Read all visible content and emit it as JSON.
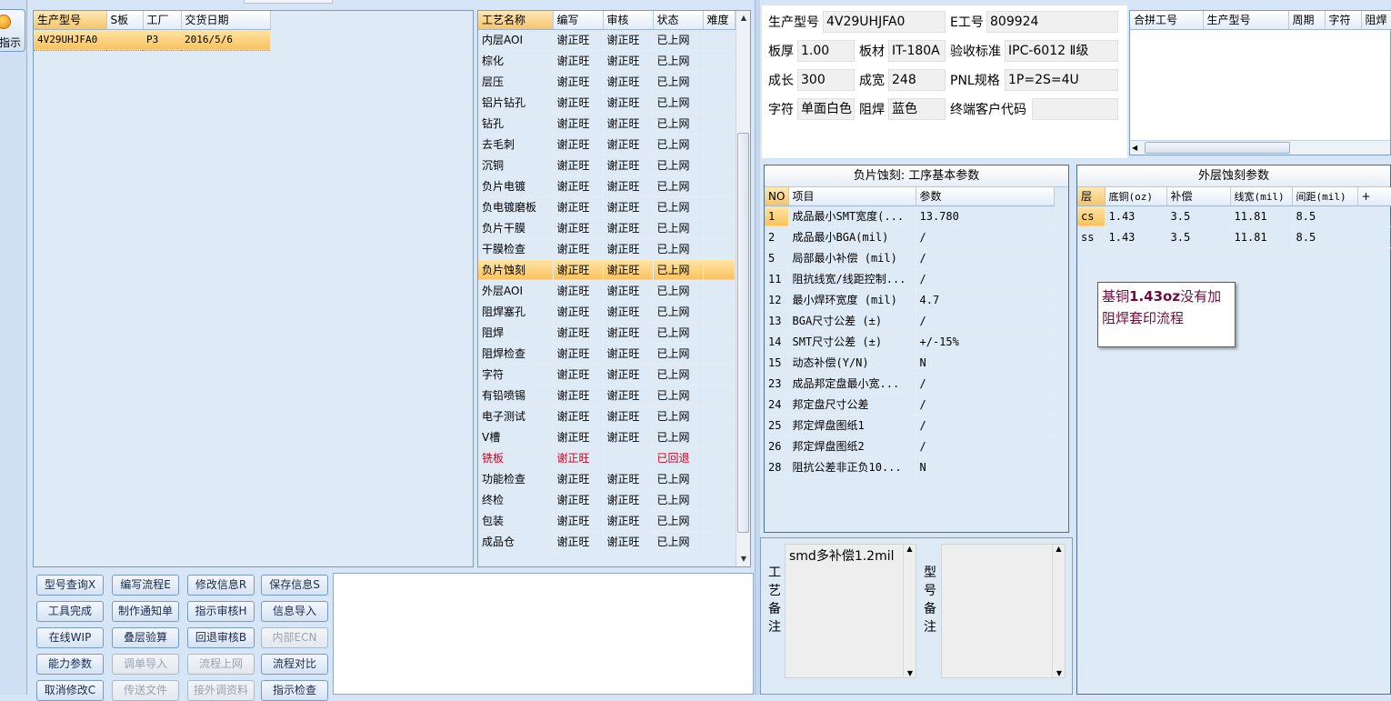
{
  "left_button": {
    "label": "指示"
  },
  "orders": {
    "columns": [
      "生产型号",
      "S板",
      "工厂",
      "交货日期"
    ],
    "rows": [
      [
        "4V29UHJFA0",
        "",
        "P3",
        "2016/5/6"
      ]
    ]
  },
  "process": {
    "columns": [
      "工艺名称",
      "编写",
      "审核",
      "状态",
      "难度"
    ],
    "rows": [
      [
        "内层AOI",
        "谢正旺",
        "谢正旺",
        "已上网",
        ""
      ],
      [
        "棕化",
        "谢正旺",
        "谢正旺",
        "已上网",
        ""
      ],
      [
        "层压",
        "谢正旺",
        "谢正旺",
        "已上网",
        ""
      ],
      [
        "铝片钻孔",
        "谢正旺",
        "谢正旺",
        "已上网",
        ""
      ],
      [
        "钻孔",
        "谢正旺",
        "谢正旺",
        "已上网",
        ""
      ],
      [
        "去毛刺",
        "谢正旺",
        "谢正旺",
        "已上网",
        ""
      ],
      [
        "沉铜",
        "谢正旺",
        "谢正旺",
        "已上网",
        ""
      ],
      [
        "负片电镀",
        "谢正旺",
        "谢正旺",
        "已上网",
        ""
      ],
      [
        "负电镀磨板",
        "谢正旺",
        "谢正旺",
        "已上网",
        ""
      ],
      [
        "负片干膜",
        "谢正旺",
        "谢正旺",
        "已上网",
        ""
      ],
      [
        "干膜检查",
        "谢正旺",
        "谢正旺",
        "已上网",
        ""
      ],
      [
        "负片蚀刻",
        "谢正旺",
        "谢正旺",
        "已上网",
        ""
      ],
      [
        "外层AOI",
        "谢正旺",
        "谢正旺",
        "已上网",
        ""
      ],
      [
        "阻焊塞孔",
        "谢正旺",
        "谢正旺",
        "已上网",
        ""
      ],
      [
        "阻焊",
        "谢正旺",
        "谢正旺",
        "已上网",
        ""
      ],
      [
        "阻焊检查",
        "谢正旺",
        "谢正旺",
        "已上网",
        ""
      ],
      [
        "字符",
        "谢正旺",
        "谢正旺",
        "已上网",
        ""
      ],
      [
        "有铅喷锡",
        "谢正旺",
        "谢正旺",
        "已上网",
        ""
      ],
      [
        "电子测试",
        "谢正旺",
        "谢正旺",
        "已上网",
        ""
      ],
      [
        "V槽",
        "谢正旺",
        "谢正旺",
        "已上网",
        ""
      ],
      [
        "铣板",
        "谢正旺",
        "",
        "已回退",
        ""
      ],
      [
        "功能检查",
        "谢正旺",
        "谢正旺",
        "已上网",
        ""
      ],
      [
        "终检",
        "谢正旺",
        "谢正旺",
        "已上网",
        ""
      ],
      [
        "包装",
        "谢正旺",
        "谢正旺",
        "已上网",
        ""
      ],
      [
        "成品仓",
        "谢正旺",
        "谢正旺",
        "已上网",
        ""
      ]
    ],
    "selected_index": 11,
    "highlight_color": "#d0021b"
  },
  "buttons": [
    [
      {
        "label": "型号查询X",
        "enabled": true
      },
      {
        "label": "编写流程E",
        "enabled": true
      },
      {
        "label": "修改信息R",
        "enabled": true
      },
      {
        "label": "保存信息S",
        "enabled": true
      }
    ],
    [
      {
        "label": "工具完成",
        "enabled": true
      },
      {
        "label": "制作通知单",
        "enabled": true
      },
      {
        "label": "指示审核H",
        "enabled": true
      },
      {
        "label": "信息导入",
        "enabled": true
      }
    ],
    [
      {
        "label": "在线WIP",
        "enabled": true
      },
      {
        "label": "叠层验算",
        "enabled": true
      },
      {
        "label": "回退审核B",
        "enabled": true
      },
      {
        "label": "内部ECN",
        "enabled": false
      }
    ],
    [
      {
        "label": "能力参数",
        "enabled": true
      },
      {
        "label": "调单导入",
        "enabled": false
      },
      {
        "label": "流程上网",
        "enabled": false
      },
      {
        "label": "流程对比",
        "enabled": true
      }
    ],
    [
      {
        "label": "取消修改C",
        "enabled": true
      },
      {
        "label": "传送文件",
        "enabled": false
      },
      {
        "label": "接外调资料",
        "enabled": false
      },
      {
        "label": "指示检查",
        "enabled": true
      }
    ]
  ],
  "info": {
    "model_label": "生产型号",
    "model": "4V29UHJFA0",
    "eno_label": "E工号",
    "eno": "809924",
    "thickness_label": "板厚",
    "thickness": "1.00",
    "material_label": "板材",
    "material": "IT-180A",
    "standard_label": "验收标准",
    "standard": "IPC-6012 Ⅱ级",
    "length_label": "成长",
    "length": "300",
    "width_label": "成宽",
    "width": "248",
    "pnl_label": "PNL规格",
    "pnl": "1P=2S=4U",
    "char_label": "字符",
    "char": "单面白色",
    "mask_label": "阻焊",
    "mask": "蓝色",
    "customer_label": "终端客户代码",
    "customer": ""
  },
  "merge": {
    "columns": [
      "合拼工号",
      "生产型号",
      "周期",
      "字符",
      "阻焊"
    ]
  },
  "params": {
    "title": "负片蚀刻: 工序基本参数",
    "columns": [
      "NO",
      "项目",
      "参数"
    ],
    "rows": [
      [
        "1",
        "成品最小SMT宽度(...",
        "13.780"
      ],
      [
        "2",
        "成品最小BGA(mil)",
        "/"
      ],
      [
        "5",
        "局部最小补偿 (mil)",
        "/"
      ],
      [
        "11",
        "阻抗线宽/线距控制...",
        "/"
      ],
      [
        "12",
        "最小焊环宽度 (mil)",
        "4.7"
      ],
      [
        "13",
        "BGA尺寸公差 (±)",
        "/"
      ],
      [
        "14",
        "SMT尺寸公差 (±)",
        "+/-15%"
      ],
      [
        "15",
        "动态补偿(Y/N)",
        "N"
      ],
      [
        "23",
        "成品邦定盘最小宽...",
        "/"
      ],
      [
        "24",
        "邦定盘尺寸公差",
        "/"
      ],
      [
        "25",
        "邦定焊盘图纸1",
        "/"
      ],
      [
        "26",
        "邦定焊盘图纸2",
        "/"
      ],
      [
        "28",
        "阻抗公差非正负10...",
        "N"
      ]
    ]
  },
  "outer": {
    "title": "外层蚀刻参数",
    "columns": [
      "层",
      "底铜(oz)",
      "补偿",
      "线宽(mil)",
      "间距(mil)",
      "+"
    ],
    "rows": [
      [
        "cs",
        "1.43",
        "3.5",
        "11.81",
        "8.5",
        ""
      ],
      [
        "ss",
        "1.43",
        "3.5",
        "11.81",
        "8.5",
        ""
      ]
    ]
  },
  "note": {
    "prefix": "基铜",
    "bold": "1.43oz",
    "suffix": "没有加",
    "line2": "阻焊套印流程",
    "color": "#6b0f3a"
  },
  "process_remark": {
    "label": "工艺备注",
    "text": "smd多补偿1.2mil"
  },
  "model_remark": {
    "label": "型号备注",
    "text": ""
  }
}
